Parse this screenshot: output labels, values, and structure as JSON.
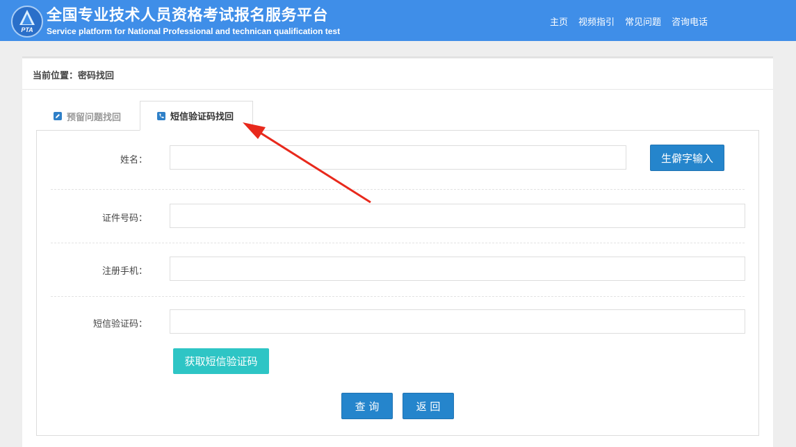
{
  "header": {
    "logo_text": "PTA",
    "title": "全国专业技术人员资格考试报名服务平台",
    "subtitle": "Service platform for National Professional and technican qualification test",
    "nav": [
      "主页",
      "视频指引",
      "常见问题",
      "咨询电话"
    ]
  },
  "breadcrumb": "当前位置：密码找回",
  "tabs": [
    {
      "label": "预留问题找回",
      "icon": "pencil-icon",
      "active": false
    },
    {
      "label": "短信验证码找回",
      "icon": "phone-icon",
      "active": true
    }
  ],
  "form": {
    "name_label": "姓名：",
    "name_value": "",
    "rare_char_button": "生僻字输入",
    "id_label": "证件号码：",
    "id_value": "",
    "phone_label": "注册手机：",
    "phone_value": "",
    "sms_label": "短信验证码：",
    "sms_value": "",
    "get_code_button": "获取短信验证码",
    "query_button": "查 询",
    "back_button": "返 回"
  },
  "colors": {
    "header_bg": "#3f8ee8",
    "primary_button": "#2585cc",
    "sms_button": "#2ec5c5",
    "annotation_arrow": "#e8291c"
  }
}
